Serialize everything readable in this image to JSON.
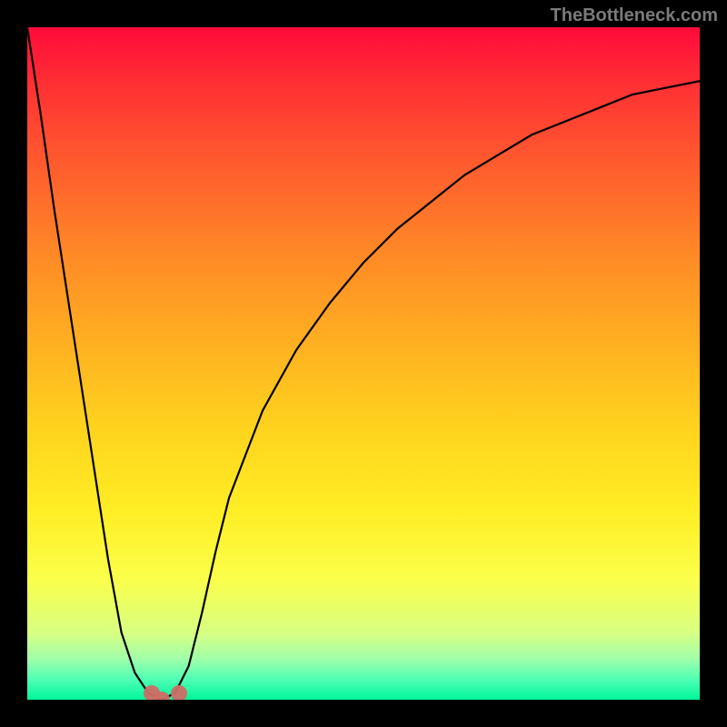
{
  "attribution": "TheBottleneck.com",
  "chart_data": {
    "type": "line",
    "title": "",
    "xlabel": "",
    "ylabel": "",
    "xlim": [
      0,
      100
    ],
    "ylim": [
      0,
      100
    ],
    "x": [
      0,
      2,
      4,
      6,
      8,
      10,
      12,
      14,
      16,
      18,
      20,
      22,
      24,
      26,
      28,
      30,
      35,
      40,
      45,
      50,
      55,
      60,
      65,
      70,
      75,
      80,
      85,
      90,
      95,
      100
    ],
    "y": [
      100,
      87,
      73,
      60,
      47,
      34,
      21,
      10,
      4,
      1,
      0,
      1,
      5,
      13,
      22,
      30,
      43,
      52,
      59,
      65,
      70,
      74,
      78,
      81,
      84,
      86,
      88,
      90,
      91,
      92
    ],
    "notes": "V-shaped curve; minimum (optimal / zero-bottleneck point) near x≈20. Background is a red→green vertical gradient where green at the bottom denotes the ideal region.",
    "markers": [
      {
        "name": "dip-marker",
        "x": 18.5,
        "y": 1
      },
      {
        "name": "dip-marker",
        "x": 20.0,
        "y": 0
      },
      {
        "name": "dip-marker",
        "x": 22.5,
        "y": 1
      }
    ]
  },
  "colors": {
    "gradient_top": "#ff0a3a",
    "gradient_bottom": "#00f59b",
    "curve": "#000000",
    "marker": "#cf6d66",
    "attribution_text": "#7a7a7a"
  }
}
